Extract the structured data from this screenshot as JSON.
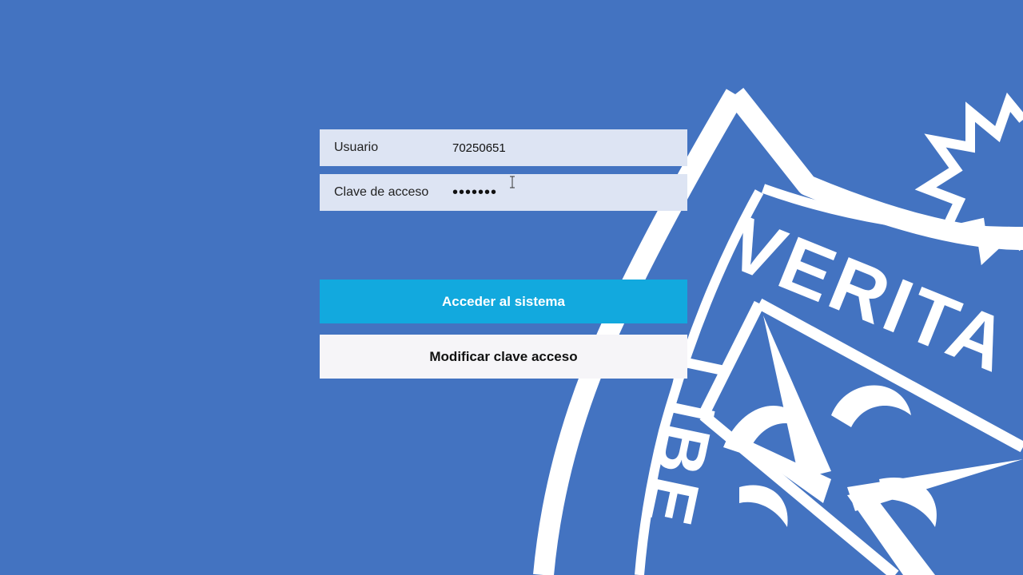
{
  "colors": {
    "background": "#4373c1",
    "field_background": "#dde4f3",
    "primary_button": "#12a9de",
    "secondary_button": "#f6f5f8",
    "watermark": "#ffffff"
  },
  "watermark": {
    "text_top": "VERITA",
    "text_bottom": "LIBE",
    "icon": "university-crest-icon"
  },
  "login": {
    "username_label": "Usuario",
    "username_value": "70250651",
    "password_label": "Clave de acceso",
    "password_value": "•••••••",
    "submit_label": "Acceder al sistema",
    "change_password_label": "Modificar clave acceso"
  }
}
